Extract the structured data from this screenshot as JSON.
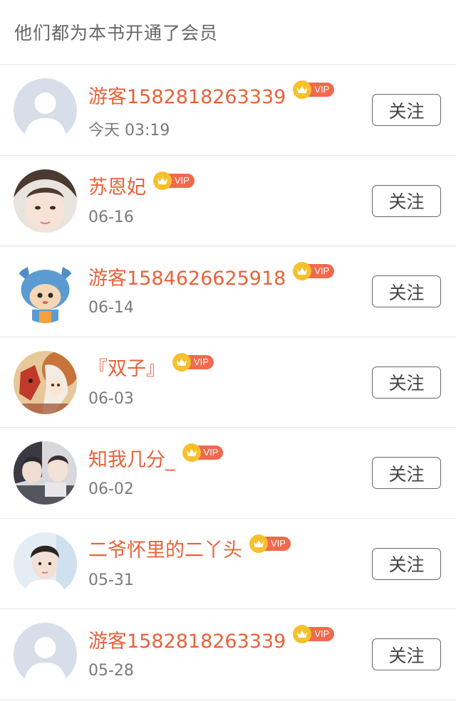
{
  "header": {
    "title": "他们都为本书开通了会员"
  },
  "vip_label": "VIP",
  "follow_label": "关注",
  "colors": {
    "name": "#e8623a",
    "vip_badge": "#f06a4e",
    "crown": "#f7c12c",
    "time": "#7a7a7a"
  },
  "members": [
    {
      "name": "游客1582818263339",
      "time": "今天 03:19",
      "avatar": "default-avatar-icon"
    },
    {
      "name": "苏恩妃",
      "time": "06-16",
      "avatar": "user-photo"
    },
    {
      "name": "游客1584626625918",
      "time": "06-14",
      "avatar": "cartoon-avatar"
    },
    {
      "name": "『双子』",
      "time": "06-03",
      "avatar": "illustration-avatar"
    },
    {
      "name": "知我几分_",
      "time": "06-02",
      "avatar": "user-photo"
    },
    {
      "name": "二爷怀里的二丫头",
      "time": "05-31",
      "avatar": "user-photo"
    },
    {
      "name": "游客1582818263339",
      "time": "05-28",
      "avatar": "default-avatar-icon"
    }
  ]
}
